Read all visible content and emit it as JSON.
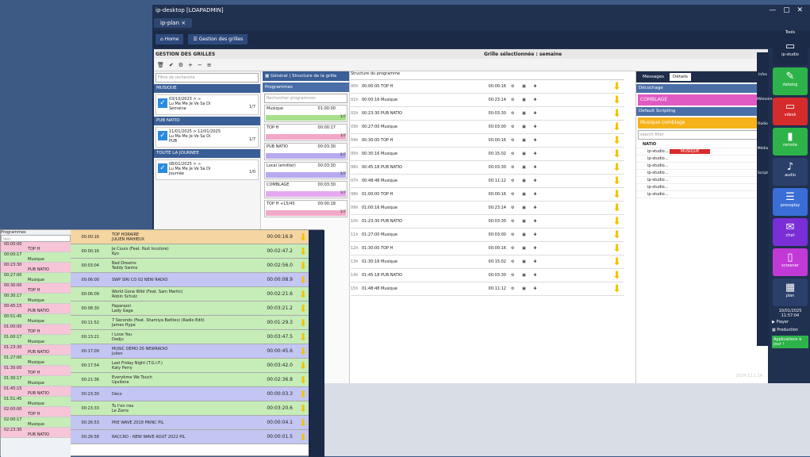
{
  "window": {
    "title": "ip-desktop [LOAPADMIN]",
    "tab": "ip-plan",
    "close": "×",
    "tools": "Tools"
  },
  "nav": {
    "home": "Home",
    "grid_tab": "Gestion des grilles"
  },
  "header": {
    "title": "GESTION DES GRILLES",
    "selected": "Grille sélectionnée : semaine"
  },
  "left": {
    "search_placeholder": "Filtre de recherche",
    "sections": [
      {
        "name": "MUSIQUE",
        "rule": "03/10/2023 > ∞",
        "days": "Lu Ma Me Je Ve Sa Di",
        "label": "Semaine",
        "count": "1/7"
      },
      {
        "name": "PUB NATIO",
        "rule": "11/01/2025 > 12/01/2025",
        "days": "Lu Ma Me Je Ve Sa Di",
        "label": "PUB",
        "count": "1/7"
      },
      {
        "name": "TOUTE LA JOURNEE",
        "rule": "08/01/2025 > ∞",
        "days": "Lu Ma Me Je Ve Sa Di",
        "label": "Journée",
        "count": "1/0"
      }
    ]
  },
  "center": {
    "tab1": "Général",
    "tab2": "Structure de la grille",
    "programmes": "Programmes",
    "search": "Rechercher programmes",
    "items": [
      {
        "name": "Musique",
        "dur": "01:00:00",
        "counter": "1/7",
        "color": "#a7e08a"
      },
      {
        "name": "TOP H",
        "dur": "00:00:17",
        "counter": "1/7",
        "color": "#f2a8c8"
      },
      {
        "name": "PUB NATIO",
        "dur": "00:03:30",
        "counter": "2/7",
        "color": "#b8a9f0"
      },
      {
        "name": "Local (emitter)",
        "dur": "00:03:30",
        "counter": "1/7",
        "color": "#b8a9f0"
      },
      {
        "name": "COMBLAGE",
        "dur": "00:03:30",
        "counter": "1/7",
        "color": "#e4a8f0"
      },
      {
        "name": "TOP H +15/45",
        "dur": "00:00:18",
        "counter": "1/7",
        "color": "#f2a8c8"
      }
    ]
  },
  "grid": {
    "struct_label": "Structure du programme",
    "rows": [
      {
        "h": "00h",
        "t": "23:59:30\n00:01:20",
        "name": "00:00:00 TOP H",
        "dur": "00:00:16"
      },
      {
        "h": "01h",
        "t": "",
        "name": "00:00:16 Musique",
        "dur": "00:23:14"
      },
      {
        "h": "02h",
        "t": "00:19:30",
        "name": "00:23:30 PUB NATIO",
        "dur": "00:03:30"
      },
      {
        "h": "03h",
        "t": "",
        "name": "00:27:00 Musique",
        "dur": "00:03:00"
      },
      {
        "h": "04h",
        "t": "00:28:30",
        "name": "00:30:00 TOP H",
        "dur": "00:00:16"
      },
      {
        "h": "05h",
        "t": "",
        "name": "00:30:16 Musique",
        "dur": "00:15:02"
      },
      {
        "h": "06h",
        "t": "00:40:15",
        "name": "00:45:18 PUB NATIO",
        "dur": "00:03:30"
      },
      {
        "h": "07h",
        "t": "",
        "name": "00:48:48 Musique",
        "dur": "00:11:12"
      },
      {
        "h": "08h",
        "t": "00:58:30",
        "name": "01:00:00 TOP H",
        "dur": "00:00:16"
      },
      {
        "h": "09h",
        "t": "",
        "name": "01:00:16 Musique",
        "dur": "00:23:14"
      },
      {
        "h": "10h",
        "t": "01:19:30",
        "name": "01:23:30 PUB NATIO",
        "dur": "00:03:30"
      },
      {
        "h": "11h",
        "t": "",
        "name": "01:27:00 Musique",
        "dur": "00:03:00"
      },
      {
        "h": "12h",
        "t": "01:28:30",
        "name": "01:30:00 TOP H",
        "dur": "00:00:16"
      },
      {
        "h": "13h",
        "t": "",
        "name": "01:30:16 Musique",
        "dur": "00:15:02"
      },
      {
        "h": "14h",
        "t": "01:40:18",
        "name": "01:45:18 PUB NATIO",
        "dur": "00:03:30"
      },
      {
        "h": "15h",
        "t": "",
        "name": "01:48:48 Musique",
        "dur": "00:11:12"
      }
    ]
  },
  "right": {
    "tab_messages": "Messages",
    "tab_details": "Détails",
    "decochage": "Décochage",
    "comblage": "COMBLAGE",
    "default_scripting": "Default Scripting",
    "musique_comblage": "Musique comblage",
    "filter": "search filter",
    "tree_root": "NATIO",
    "tree_first": "ip-studio...",
    "musique_tag": "MUSIQUE",
    "tree_items": [
      "ip-studio...",
      "ip-studio...",
      "ip-studio...",
      "ip-studio...",
      "ip-studio...",
      "ip-studio..."
    ]
  },
  "vtools": [
    "Infos",
    "Mémoire",
    "Radio",
    "Média",
    "Script"
  ],
  "sidebar": {
    "btns": [
      {
        "label": "ip-studio",
        "color": "#1a2a47",
        "icon": "▭"
      },
      {
        "label": "datalog",
        "color": "#2eb34a",
        "icon": "✎"
      },
      {
        "label": "vdesk",
        "color": "#d62b2b",
        "icon": "▭"
      },
      {
        "label": "remote",
        "color": "#2eb34a",
        "icon": "▮"
      },
      {
        "label": "audio",
        "color": "#2a3f6a",
        "icon": "♪"
      },
      {
        "label": "presoplay",
        "color": "#3a6ed6",
        "icon": "☰"
      },
      {
        "label": "chat",
        "color": "#7a2fd6",
        "icon": "✉"
      },
      {
        "label": "screener",
        "color": "#c23ad6",
        "icon": "▯"
      },
      {
        "label": "plan",
        "color": "#2a3f6a",
        "icon": "▦"
      }
    ],
    "date": "10/01/2025",
    "time": "11:57:04",
    "player": "Player",
    "production": "Production",
    "apps": "Applications à jour !",
    "version": "2024.12.1.14"
  },
  "w2": {
    "title": "Programmes",
    "filter": "Voir",
    "slots": [
      {
        "t": "00:00:00",
        "n": "TOP H",
        "k": "a"
      },
      {
        "t": "00:00:17",
        "n": "Musique",
        "k": "b"
      },
      {
        "t": "00:23:30",
        "n": "PUB NATIO",
        "k": "a"
      },
      {
        "t": "00:27:00",
        "n": "Musique",
        "k": "b"
      },
      {
        "t": "00:30:00",
        "n": "TOP H",
        "k": "a"
      },
      {
        "t": "00:30:17",
        "n": "Musique",
        "k": "b"
      },
      {
        "t": "00:45:15",
        "n": "PUB NATIO",
        "k": "a"
      },
      {
        "t": "00:51:45",
        "n": "Musique",
        "k": "b"
      },
      {
        "t": "01:00:00",
        "n": "TOP H",
        "k": "a"
      },
      {
        "t": "01:00:17",
        "n": "Musique",
        "k": "b"
      },
      {
        "t": "01:23:30",
        "n": "PUB NATIO",
        "k": "a"
      },
      {
        "t": "01:27:00",
        "n": "Musique",
        "k": "b"
      },
      {
        "t": "01:30:00",
        "n": "TOP H",
        "k": "a"
      },
      {
        "t": "01:30:17",
        "n": "Musique",
        "k": "b"
      },
      {
        "t": "01:45:15",
        "n": "PUB NATIO",
        "k": "a"
      },
      {
        "t": "01:51:45",
        "n": "Musique",
        "k": "b"
      },
      {
        "t": "02:00:00",
        "n": "TOP H",
        "k": "a"
      },
      {
        "t": "02:00:17",
        "n": "Musique",
        "k": "b"
      },
      {
        "t": "02:23:30",
        "n": "PUB NATIO",
        "k": "a"
      }
    ],
    "tracks": [
      {
        "h": "00:00:16",
        "n": "TOP HORAIRE\nJULIEN MAHIEUX",
        "d": "00:00:16.9",
        "c": "#f5d5a0"
      },
      {
        "h": "00:00:16",
        "n": "Je Cours (Feat. Nuit Incolore)\nKyo",
        "d": "00:02:47.2",
        "c": "#c6ecb8"
      },
      {
        "h": "00:03:04",
        "n": "Bad Dreams\nTeddy Swims",
        "d": "00:02:56.0",
        "c": "#c6ecb8"
      },
      {
        "h": "00:06:00",
        "n": "SWP SIRI CO 02 NEW RADIO",
        "d": "00:00:08.9",
        "c": "#c3c6f2"
      },
      {
        "h": "00:06:09",
        "n": "World Gone Wild (Feat. Sam Martin)\nRobin Schulz",
        "d": "00:02:21.6",
        "c": "#c6ecb8"
      },
      {
        "h": "00:08:30",
        "n": "Paparazzi\nLady Gaga",
        "d": "00:03:21.2",
        "c": "#c6ecb8"
      },
      {
        "h": "00:11:52",
        "n": "7 Seconds (Feat. Shamiya Battles) (Radio Edit)\nJames Hype",
        "d": "00:01:29.3",
        "c": "#c6ecb8"
      },
      {
        "h": "00:13:21",
        "n": "I Love You\nDadju",
        "d": "00:03:47.5",
        "c": "#c6ecb8"
      },
      {
        "h": "00:17:09",
        "n": "MUSIC DEMO 05 NEWRADIO\nJulien",
        "d": "00:00:45.6",
        "c": "#c3c6f2"
      },
      {
        "h": "00:17:54",
        "n": "Last Friday Night (T.G.I.F.)\nKaty Perry",
        "d": "00:03:42.0",
        "c": "#c6ecb8"
      },
      {
        "h": "00:21:36",
        "n": "Everytime We Touch\nUpsilone",
        "d": "00:02:36.8",
        "c": "#c6ecb8"
      },
      {
        "h": "00:23:30",
        "n": "Déco",
        "d": "00:00:03.3",
        "c": "#c3c6f2"
      },
      {
        "h": "00:23:33",
        "n": "Tu t'en iras\nLe Zarra",
        "d": "00:03:20.6",
        "c": "#c6ecb8"
      },
      {
        "h": "00:26:53",
        "n": "PRE WAVE 2018 PRINC PIL",
        "d": "00:00:04.1",
        "c": "#c3c6f2"
      },
      {
        "h": "00:26:58",
        "n": "RACCRO - NEW WAVE AOUT 2022 PIL",
        "d": "00:00:01.5",
        "c": "#c3c6f2"
      }
    ]
  }
}
